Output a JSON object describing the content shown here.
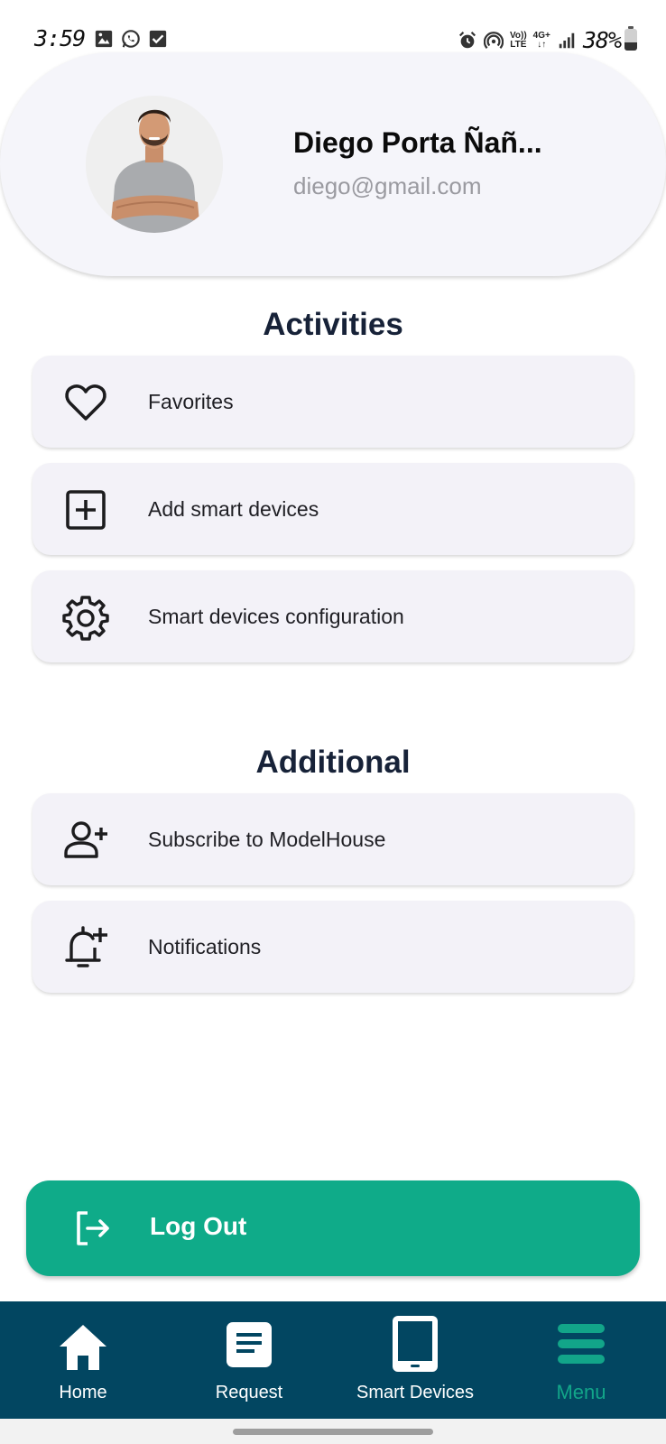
{
  "status_bar": {
    "time": "3:59",
    "volte_top": "Vo))",
    "volte_bottom": "LTE",
    "network": "4G+",
    "battery_text": "38%",
    "battery_level": 0.38
  },
  "profile": {
    "name": "Diego Porta Ñañ...",
    "email": "diego@gmail.com"
  },
  "activities": {
    "title": "Activities",
    "items": [
      {
        "label": "Favorites",
        "icon": "heart-icon"
      },
      {
        "label": "Add smart devices",
        "icon": "plus-square-icon"
      },
      {
        "label": "Smart devices configuration",
        "icon": "gear-icon"
      }
    ]
  },
  "additional": {
    "title": "Additional",
    "items": [
      {
        "label": "Subscribe to ModelHouse",
        "icon": "person-add-icon"
      },
      {
        "label": "Notifications",
        "icon": "bell-add-icon"
      }
    ]
  },
  "logout": {
    "label": "Log Out",
    "icon": "logout-icon"
  },
  "bottom_nav": {
    "items": [
      {
        "label": "Home",
        "icon": "home-icon",
        "active": false
      },
      {
        "label": "Request",
        "icon": "document-icon",
        "active": false
      },
      {
        "label": "Smart Devices",
        "icon": "tablet-icon",
        "active": false
      },
      {
        "label": "Menu",
        "icon": "menu-icon",
        "active": true
      }
    ]
  },
  "colors": {
    "accent": "#0fab89",
    "nav_background": "#024661",
    "card_background": "#f3f2f8",
    "title_color": "#172238"
  }
}
